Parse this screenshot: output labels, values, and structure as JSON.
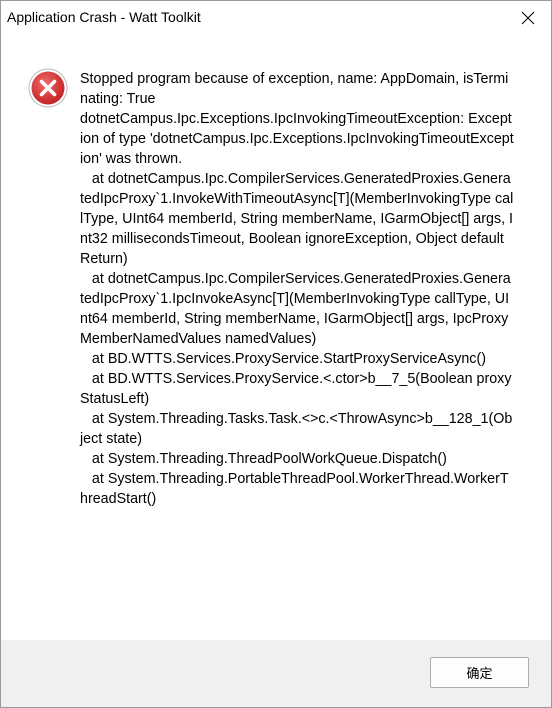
{
  "window": {
    "title": "Application Crash - Watt Toolkit"
  },
  "titlebar": {
    "close_icon": "close-icon"
  },
  "dialog": {
    "icon": "error-icon",
    "icon_color": "#d43737",
    "message": "Stopped program because of exception, name: AppDomain, isTerminating: True\ndotnetCampus.Ipc.Exceptions.IpcInvokingTimeoutException: Exception of type 'dotnetCampus.Ipc.Exceptions.IpcInvokingTimeoutException' was thrown.\n   at dotnetCampus.Ipc.CompilerServices.GeneratedProxies.GeneratedIpcProxy`1.InvokeWithTimeoutAsync[T](MemberInvokingType callType, UInt64 memberId, String memberName, IGarmObject[] args, Int32 millisecondsTimeout, Boolean ignoreException, Object defaultReturn)\n   at dotnetCampus.Ipc.CompilerServices.GeneratedProxies.GeneratedIpcProxy`1.IpcInvokeAsync[T](MemberInvokingType callType, UInt64 memberId, String memberName, IGarmObject[] args, IpcProxyMemberNamedValues namedValues)\n   at BD.WTTS.Services.ProxyService.StartProxyServiceAsync()\n   at BD.WTTS.Services.ProxyService.<.ctor>b__7_5(Boolean proxyStatusLeft)\n   at System.Threading.Tasks.Task.<>c.<ThrowAsync>b__128_1(Object state)\n   at System.Threading.ThreadPoolWorkQueue.Dispatch()\n   at System.Threading.PortableThreadPool.WorkerThread.WorkerThreadStart()"
  },
  "footer": {
    "ok_label": "确定"
  }
}
